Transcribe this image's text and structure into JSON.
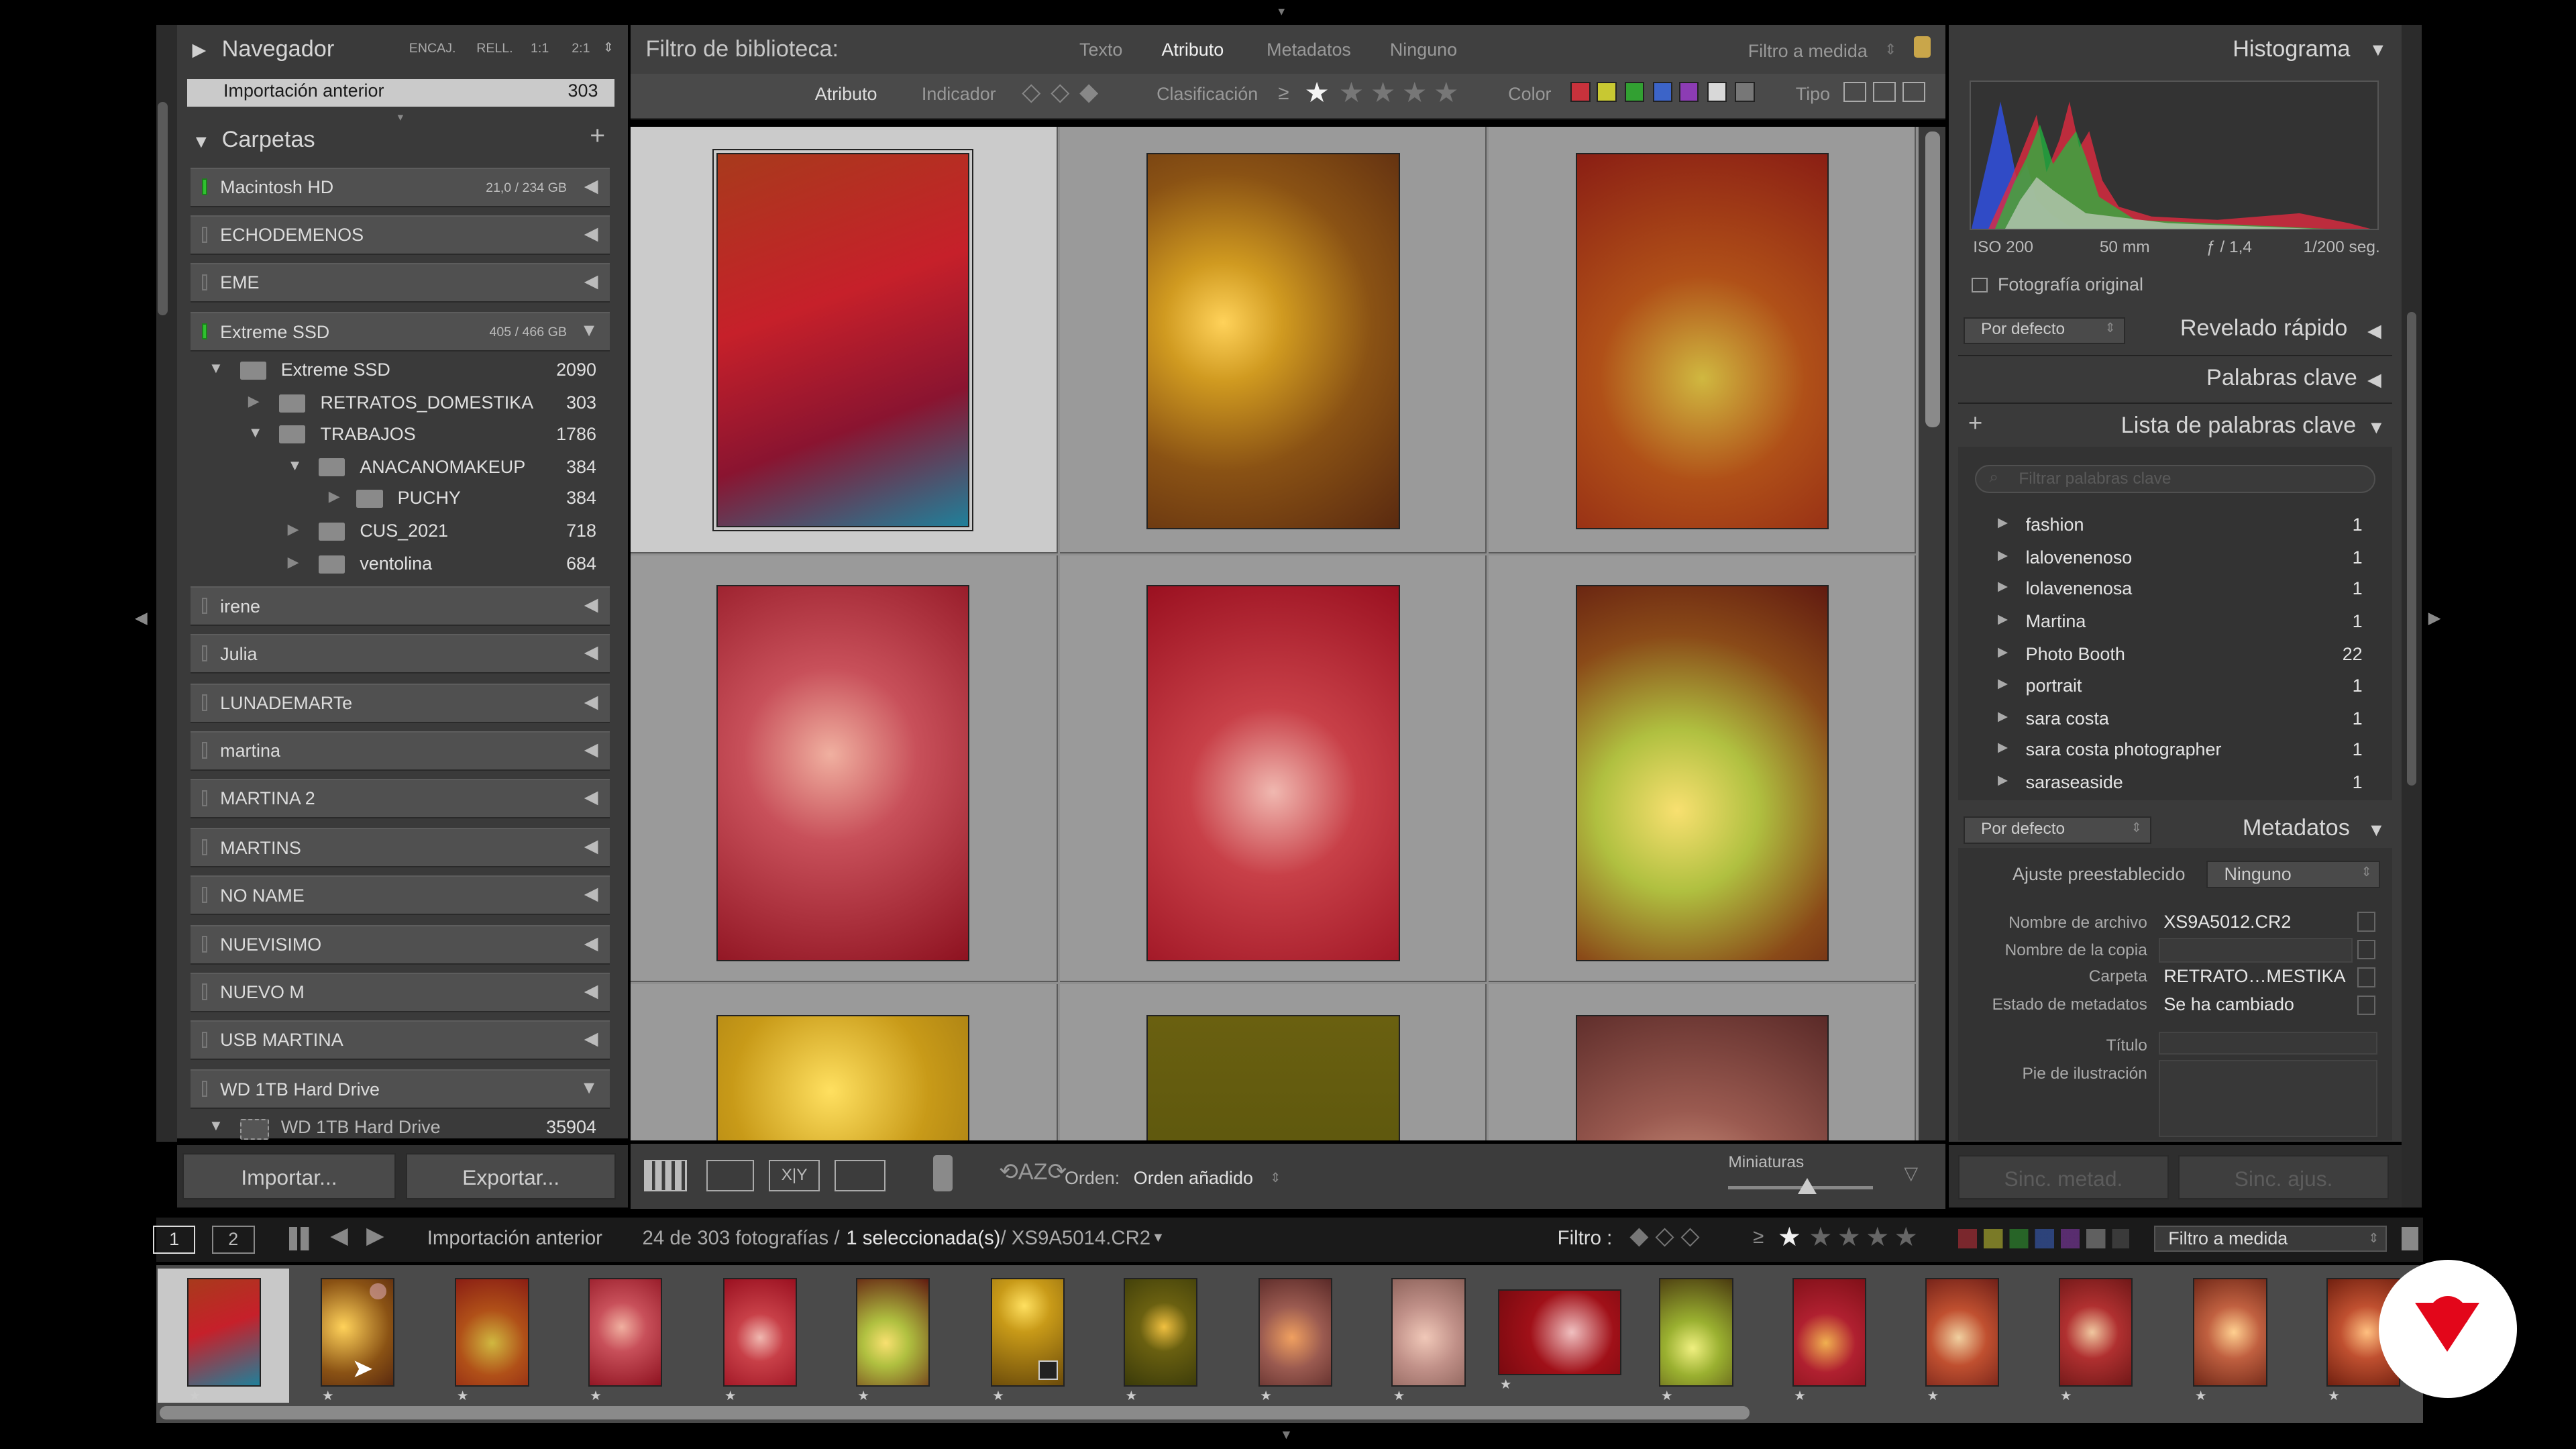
{
  "navigator": {
    "title": "Navegador",
    "modes": [
      "ENCAJ.",
      "RELL.",
      "1:1",
      "2:1"
    ],
    "collection": "Importación anterior",
    "collection_count": "303"
  },
  "folders": {
    "title": "Carpetas",
    "volumes_top": [
      {
        "name": "Macintosh HD",
        "cap": "21,0 / 234 GB",
        "on": true
      },
      {
        "name": "ECHODEMENOS",
        "cap": "",
        "on": false
      },
      {
        "name": "EME",
        "cap": "",
        "on": false
      },
      {
        "name": "Extreme SSD",
        "cap": "405 / 466 GB",
        "on": true
      }
    ],
    "tree": [
      {
        "name": "Extreme SSD",
        "count": "2090"
      },
      {
        "name": "RETRATOS_DOMESTIKA",
        "count": "303"
      },
      {
        "name": "TRABAJOS",
        "count": "1786"
      },
      {
        "name": "ANACANOMAKEUP",
        "count": "384"
      },
      {
        "name": "PUCHY",
        "count": "384"
      },
      {
        "name": "CUS_2021",
        "count": "718"
      },
      {
        "name": "ventolina",
        "count": "684"
      }
    ],
    "volumes_bottom": [
      "irene",
      "Julia",
      "LUNADEMARTe",
      "martina",
      "MARTINA 2",
      "MARTINS",
      "NO NAME",
      "NUEVISIMO",
      "NUEVO M",
      "USB MARTINA",
      "WD 1TB Hard Drive"
    ],
    "last_folder": {
      "name": "WD 1TB Hard Drive",
      "count": "35904"
    }
  },
  "left_buttons": {
    "import": "Importar...",
    "export": "Exportar..."
  },
  "filter_bar": {
    "title": "Filtro de biblioteca:",
    "tabs": [
      "Texto",
      "Atributo",
      "Metadatos",
      "Ninguno"
    ],
    "preset": "Filtro a medida",
    "attr_label": "Atributo",
    "flag_label": "Indicador",
    "rating_label": "Clasificación",
    "rating_op": "≥",
    "color_label": "Color",
    "type_label": "Tipo"
  },
  "colors": {
    "red": "#c8323c",
    "yellow": "#c8c832",
    "green": "#32a032",
    "blue": "#3c64c8",
    "purple": "#8c3cb4",
    "accent": "#cbcbcb"
  },
  "toolbar": {
    "sort_label": "Orden:",
    "sort_value": "Orden añadido",
    "thumbs_label": "Miniaturas",
    "thumb_size": 0.55
  },
  "histogram": {
    "title": "Histograma",
    "iso": "ISO 200",
    "focal": "50 mm",
    "aperture": "ƒ / 1,4",
    "shutter": "1/200 seg.",
    "original": "Fotografía original"
  },
  "quick_develop": {
    "preset": "Por defecto",
    "title": "Revelado rápido"
  },
  "keywords": {
    "title": "Palabras clave",
    "list_title": "Lista de palabras clave",
    "search_placeholder": "Filtrar palabras clave",
    "items": [
      {
        "name": "fashion",
        "count": "1"
      },
      {
        "name": "lalovenenoso",
        "count": "1"
      },
      {
        "name": "lolavenenosa",
        "count": "1"
      },
      {
        "name": "Martina",
        "count": "1"
      },
      {
        "name": "Photo Booth",
        "count": "22"
      },
      {
        "name": "portrait",
        "count": "1"
      },
      {
        "name": "sara costa",
        "count": "1"
      },
      {
        "name": "sara costa photographer",
        "count": "1"
      },
      {
        "name": "saraseaside",
        "count": "1"
      }
    ]
  },
  "metadata": {
    "preset_sel": "Por defecto",
    "title": "Metadatos",
    "preset_label": "Ajuste preestablecido",
    "preset_value": "Ninguno",
    "fields": [
      {
        "label": "Nombre de archivo",
        "value": "XS9A5012.CR2"
      },
      {
        "label": "Nombre de la copia",
        "value": ""
      },
      {
        "label": "Carpeta",
        "value": "RETRATO…MESTIKA"
      },
      {
        "label": "Estado de metadatos",
        "value": "Se ha cambiado"
      }
    ],
    "title_label": "Título",
    "caption_label": "Pie de ilustración"
  },
  "sync": {
    "meta": "Sinc. metad.",
    "settings": "Sinc. ajus."
  },
  "filmstrip_bar": {
    "page1": "1",
    "page2": "2",
    "source": "Importación anterior",
    "count_text": "24 de 303 fotografías /",
    "selected": "1 seleccionada(s)",
    "file": "/ XS9A5014.CR2",
    "filter_label": "Filtro :",
    "filter_preset": "Filtro a medida"
  }
}
